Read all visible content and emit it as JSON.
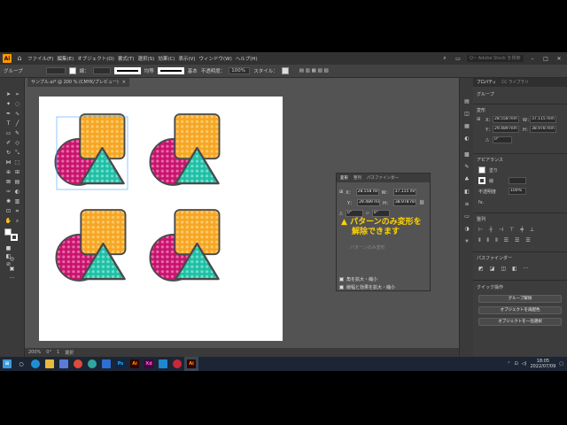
{
  "menubar": {
    "logo": "Ai",
    "items": [
      "ファイル(F)",
      "編集(E)",
      "オブジェクト(O)",
      "書式(T)",
      "選択(S)",
      "効果(C)",
      "表示(V)",
      "ウィンドウ(W)",
      "ヘルプ(H)"
    ],
    "search_placeholder": "Q~ Adobe Stock を検索"
  },
  "controlbar": {
    "selection": "グループ",
    "stroke_label": "線：",
    "stroke_style": "均等",
    "brush": "基本",
    "opacity_label": "不透明度：",
    "opacity_value": "100%",
    "style_label": "スタイル："
  },
  "document": {
    "tab_title": "サンプル.ai* @ 200 % (CMYK/プレビュー)",
    "tab_close": "×",
    "zoom": "200%",
    "rotation": "0°",
    "page": "1",
    "status": "選択"
  },
  "transform_panel": {
    "tabs": [
      "変形",
      "整列",
      "パスファインダー"
    ],
    "x_label": "X：",
    "x_value": "28.558 mm",
    "w_label": "W：",
    "w_value": "37.115 mm",
    "y_label": "Y：",
    "y_value": "29.489 mm",
    "h_label": "H：",
    "h_value": "38.978 mm",
    "angle": "0°",
    "shear": "0°",
    "section_label": "パターンのみ変形",
    "check1": "角を拡大・縮小",
    "check2": "線幅と効果を拡大・縮小"
  },
  "annotation": {
    "icon": "▲",
    "line1": "パターンのみ変形を",
    "line2": "解除できます"
  },
  "properties": {
    "tabs": [
      "プロパティ",
      "CC ライブラリ"
    ],
    "selection": "グループ",
    "transform_title": "変形",
    "x_label": "X：",
    "x_value": "28.558 mm",
    "w_label": "W：",
    "w_value": "37.115 mm",
    "y_label": "Y：",
    "y_value": "29.489 mm",
    "h_label": "H：",
    "h_value": "38.978 mm",
    "angle": "0°",
    "appearance_title": "アピアランス",
    "fill_label": "塗り",
    "stroke_label": "線",
    "opacity_label": "不透明度",
    "opacity_value": "100%",
    "fx": "fx.",
    "align_title": "整列",
    "pathfinder_title": "パスファインダー",
    "quick_title": "クイック操作",
    "quick_buttons": [
      "グループ解除",
      "オブジェクトを再配色",
      "オブジェクトを一括選択"
    ]
  },
  "taskbar": {
    "time": "18:05",
    "date": "2022/07/09",
    "apps": [
      "Ps",
      "Ai",
      "Xd",
      "Ai"
    ]
  },
  "colors": {
    "orange": "#f6a623",
    "orange_dot": "#fbc96a",
    "teal": "#1fbfa6",
    "teal_dot": "#6fe0cc",
    "magenta": "#c8136e",
    "magenta_dot": "#e86aa8",
    "stroke": "#4a4a4a",
    "annotation": "#ffd400"
  }
}
